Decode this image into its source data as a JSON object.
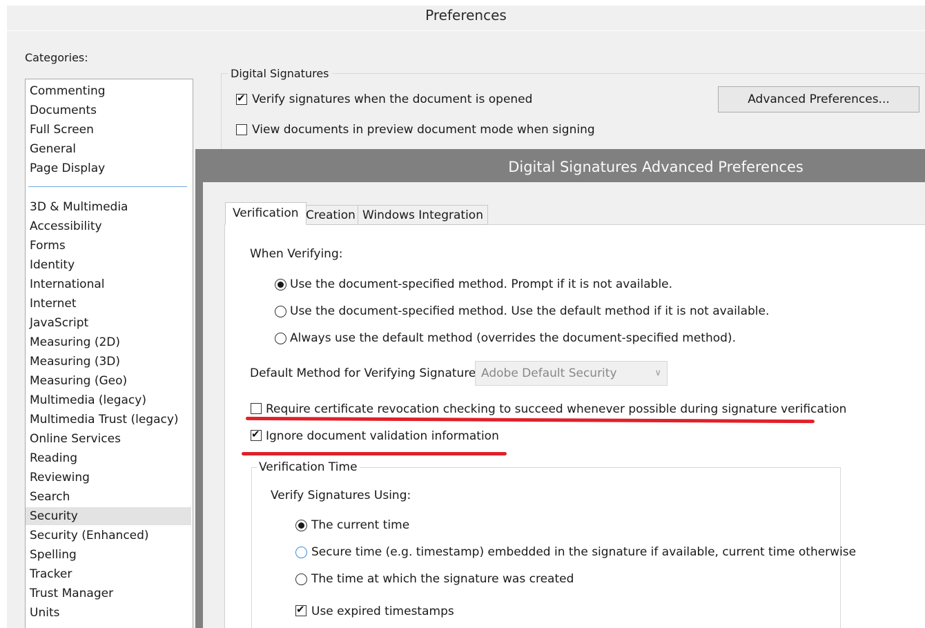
{
  "window": {
    "title": "Preferences"
  },
  "categories": {
    "label": "Categories:",
    "top_items": [
      "Commenting",
      "Documents",
      "Full Screen",
      "General",
      "Page Display"
    ],
    "items": [
      "3D & Multimedia",
      "Accessibility",
      "Forms",
      "Identity",
      "International",
      "Internet",
      "JavaScript",
      "Measuring (2D)",
      "Measuring (3D)",
      "Measuring (Geo)",
      "Multimedia (legacy)",
      "Multimedia Trust (legacy)",
      "Online Services",
      "Reading",
      "Reviewing",
      "Search",
      "Security",
      "Security (Enhanced)",
      "Spelling",
      "Tracker",
      "Trust Manager",
      "Units"
    ],
    "selected": "Security"
  },
  "digital_signatures": {
    "group_title": "Digital Signatures",
    "verify_on_open": {
      "label": "Verify signatures when the document is opened",
      "checked": true
    },
    "preview_mode": {
      "label": "View documents in preview document mode when signing",
      "checked": false
    },
    "advanced_button": "Advanced Preferences..."
  },
  "dialog": {
    "title": "Digital Signatures Advanced Preferences",
    "tabs": [
      "Verification",
      "Creation",
      "Windows Integration"
    ],
    "active_tab": "Verification",
    "when_verifying": {
      "label": "When Verifying:",
      "options": [
        "Use the document-specified method. Prompt if it is not available.",
        "Use the document-specified method. Use the default method if it is not available.",
        "Always use the default method (overrides the document-specified method)."
      ],
      "selected_index": 0
    },
    "default_method": {
      "label": "Default Method for Verifying Signatures:",
      "value": "Adobe Default Security"
    },
    "require_revocation": {
      "label": "Require certificate revocation checking to succeed whenever possible during signature verification",
      "checked": false
    },
    "ignore_validation": {
      "label": "Ignore document validation information",
      "checked": true
    },
    "verification_time": {
      "group_title": "Verification Time",
      "label": "Verify Signatures Using:",
      "options": [
        "The current time",
        "Secure time (e.g. timestamp) embedded in the signature if available, current time otherwise",
        "The time at which the signature was created"
      ],
      "selected_index": 0,
      "use_expired": {
        "label": "Use expired timestamps",
        "checked": true
      }
    }
  },
  "colors": {
    "annotation_underline": "#e0202a",
    "dialog_title_bar": "#808080",
    "focus_blue": "#3b8fd8"
  }
}
